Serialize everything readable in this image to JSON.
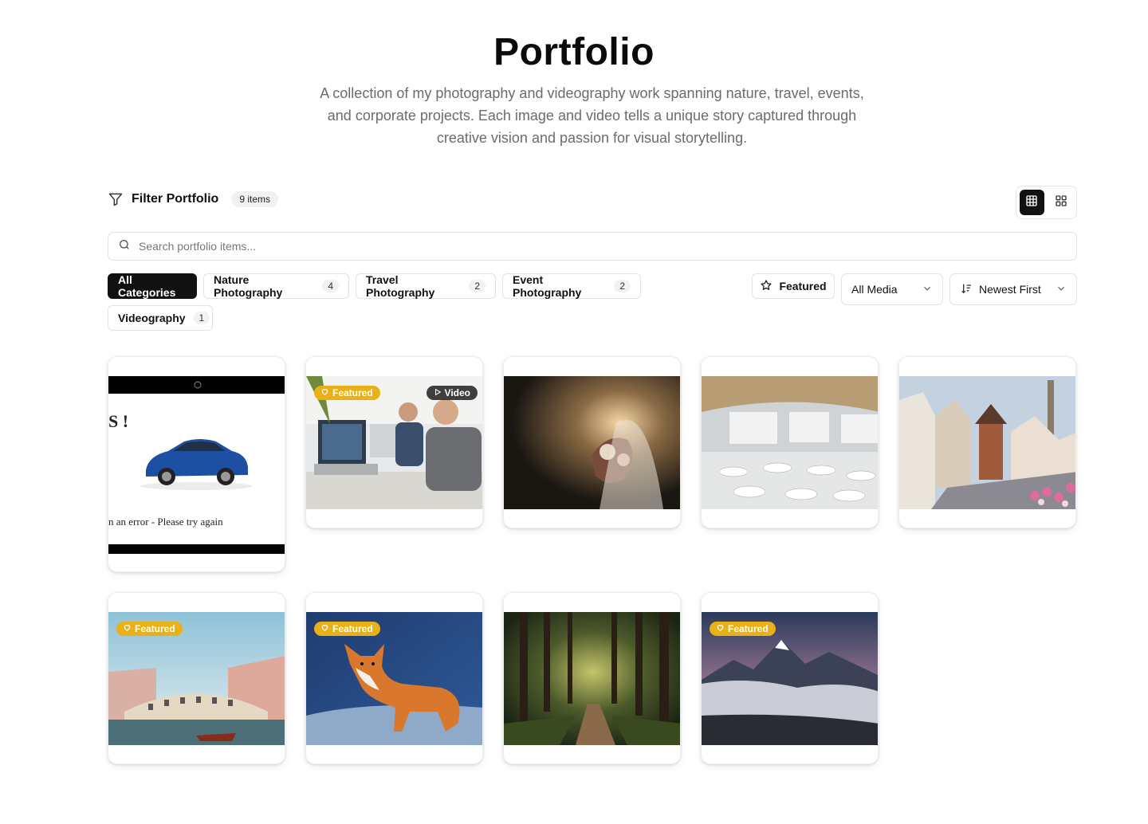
{
  "header": {
    "title": "Portfolio",
    "subtitle": "A collection of my photography and videography work spanning nature, travel, events, and corporate projects. Each image and video tells a unique story captured through creative vision and passion for visual storytelling."
  },
  "filter": {
    "label": "Filter Portfolio",
    "count": "9 items",
    "view_modes": [
      "grid-large",
      "grid-small"
    ]
  },
  "search": {
    "placeholder": "Search portfolio items..."
  },
  "categories": [
    {
      "label": "All Categories",
      "count": "",
      "active": true
    },
    {
      "label": "Nature Photography",
      "count": "4"
    },
    {
      "label": "Travel Photography",
      "count": "2"
    },
    {
      "label": "Event Photography",
      "count": "2"
    },
    {
      "label": "Videography",
      "count": "1"
    }
  ],
  "controls": {
    "featured_label": "Featured",
    "media_select": "All Media",
    "sort_select": "Newest First"
  },
  "cards": [
    {
      "name": "card-car-error",
      "badge_featured": "",
      "badge_video": "",
      "error_exclaim": "S !",
      "error_text": "n an error - Please try again"
    },
    {
      "name": "card-office",
      "badge_featured": "Featured",
      "badge_video": "Video"
    },
    {
      "name": "card-wedding",
      "badge_featured": "",
      "badge_video": ""
    },
    {
      "name": "card-conference",
      "badge_featured": "",
      "badge_video": ""
    },
    {
      "name": "card-town",
      "badge_featured": "",
      "badge_video": ""
    },
    {
      "name": "card-venice",
      "badge_featured": "Featured",
      "badge_video": ""
    },
    {
      "name": "card-fox",
      "badge_featured": "Featured",
      "badge_video": ""
    },
    {
      "name": "card-forest",
      "badge_featured": "",
      "badge_video": ""
    },
    {
      "name": "card-mountains",
      "badge_featured": "Featured",
      "badge_video": ""
    }
  ],
  "colors": {
    "accent": "#111111",
    "featured_badge": "#e9b116",
    "border": "#e3e3e3"
  }
}
